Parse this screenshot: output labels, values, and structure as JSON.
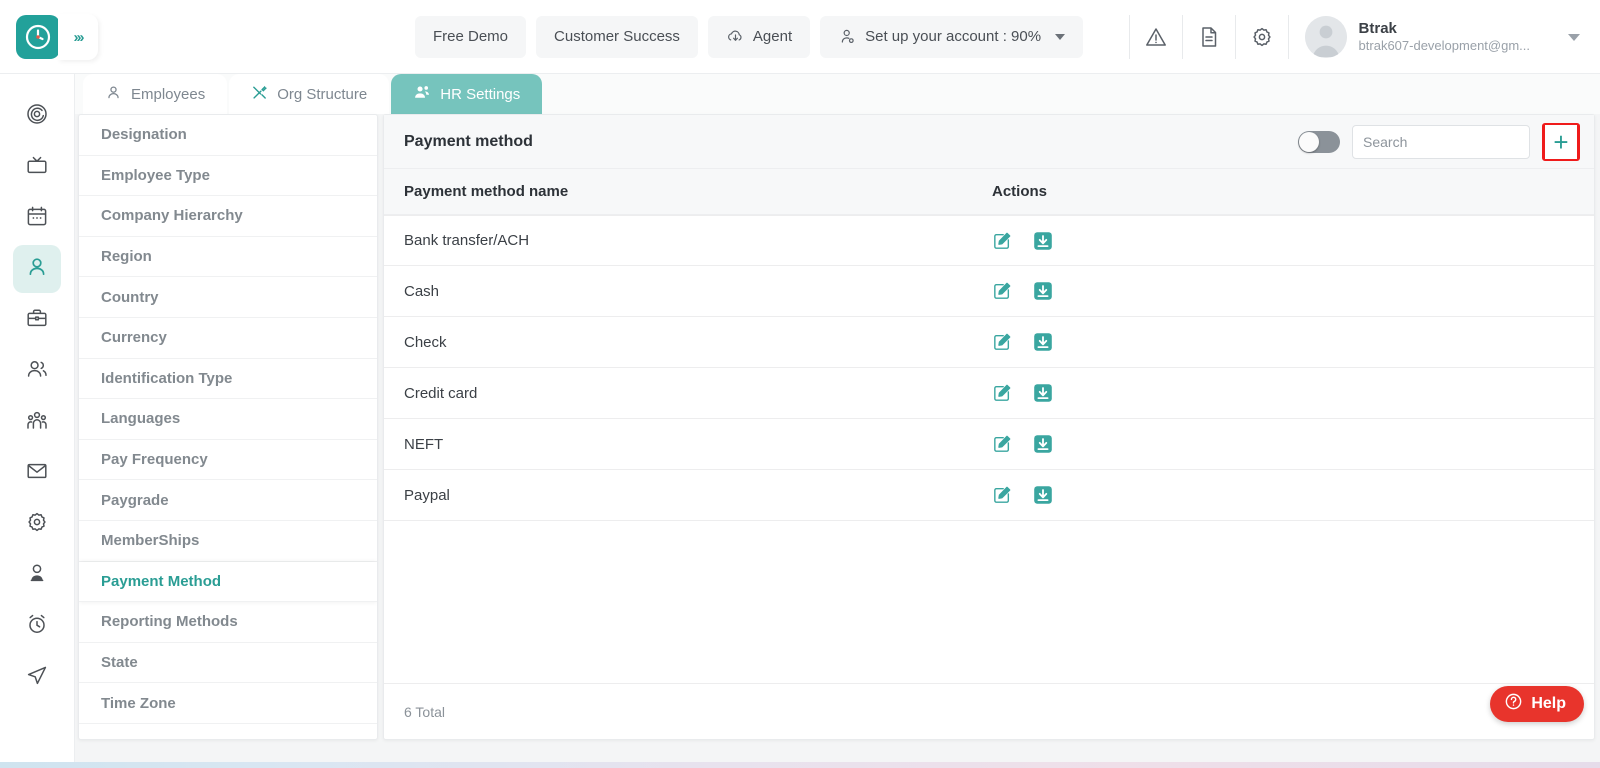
{
  "header": {
    "logo_icon": "clock-logo-icon",
    "expand_icon": "chevron-double-right-icon",
    "nav": [
      {
        "label": "Free Demo",
        "icon": null,
        "name": "free-demo-button"
      },
      {
        "label": "Customer Success",
        "icon": null,
        "name": "customer-success-button"
      },
      {
        "label": "Agent",
        "icon": "cloud-download-icon",
        "name": "agent-button"
      },
      {
        "label": "Set up your account : 90%",
        "icon": "user-gear-icon",
        "name": "setup-account-button"
      }
    ],
    "icons": [
      {
        "name": "warning-icon"
      },
      {
        "name": "document-icon"
      },
      {
        "name": "gear-icon"
      }
    ],
    "user": {
      "name": "Btrak",
      "email": "btrak607-development@gm...",
      "avatar_icon": "avatar-placeholder-icon",
      "caret_icon": "caret-down-icon"
    }
  },
  "rail": {
    "items": [
      {
        "name": "sidebar-rail-dashboard",
        "icon": "target-spiral-icon",
        "active": false
      },
      {
        "name": "sidebar-rail-tv",
        "icon": "tv-icon",
        "active": false
      },
      {
        "name": "sidebar-rail-calendar",
        "icon": "calendar-icon",
        "active": false
      },
      {
        "name": "sidebar-rail-employee",
        "icon": "person-icon",
        "active": true
      },
      {
        "name": "sidebar-rail-briefcase",
        "icon": "briefcase-icon",
        "active": false
      },
      {
        "name": "sidebar-rail-team",
        "icon": "two-people-icon",
        "active": false
      },
      {
        "name": "sidebar-rail-group",
        "icon": "people-group-icon",
        "active": false
      },
      {
        "name": "sidebar-rail-mail",
        "icon": "envelope-icon",
        "active": false
      },
      {
        "name": "sidebar-rail-settings",
        "icon": "gear-icon",
        "active": false
      },
      {
        "name": "sidebar-rail-profile",
        "icon": "user-badge-icon",
        "active": false
      },
      {
        "name": "sidebar-rail-timer",
        "icon": "alarm-clock-icon",
        "active": false
      },
      {
        "name": "sidebar-rail-send",
        "icon": "paper-plane-icon",
        "active": false
      }
    ]
  },
  "tabs": [
    {
      "label": "Employees",
      "icon": "person-icon",
      "active": false
    },
    {
      "label": "Org Structure",
      "icon": "tools-icon",
      "active": false
    },
    {
      "label": "HR Settings",
      "icon": "people-settings-icon",
      "active": true
    }
  ],
  "sidebar": {
    "items": [
      {
        "label": "Designation",
        "active": false
      },
      {
        "label": "Employee Type",
        "active": false
      },
      {
        "label": "Company Hierarchy",
        "active": false
      },
      {
        "label": "Region",
        "active": false
      },
      {
        "label": "Country",
        "active": false
      },
      {
        "label": "Currency",
        "active": false
      },
      {
        "label": "Identification Type",
        "active": false
      },
      {
        "label": "Languages",
        "active": false
      },
      {
        "label": "Pay Frequency",
        "active": false
      },
      {
        "label": "Paygrade",
        "active": false
      },
      {
        "label": "MemberShips",
        "active": false
      },
      {
        "label": "Payment Method",
        "active": true
      },
      {
        "label": "Reporting Methods",
        "active": false
      },
      {
        "label": "State",
        "active": false
      },
      {
        "label": "Time Zone",
        "active": false
      }
    ]
  },
  "panel": {
    "title": "Payment method",
    "toggle_on": false,
    "search": {
      "value": "",
      "placeholder": "Search"
    },
    "add_button": {
      "label": "+",
      "icon": "plus-icon",
      "highlighted": true,
      "highlight_color": "#ef1b1b"
    },
    "columns": [
      "Payment method name",
      "Actions"
    ],
    "rows": [
      {
        "name": "Bank transfer/ACH"
      },
      {
        "name": "Cash"
      },
      {
        "name": "Check"
      },
      {
        "name": "Credit card"
      },
      {
        "name": "NEFT"
      },
      {
        "name": "Paypal"
      }
    ],
    "row_actions": [
      {
        "name": "edit-icon"
      },
      {
        "name": "archive-down-icon"
      }
    ],
    "total_text": "6 Total"
  },
  "help": {
    "label": "Help",
    "icon": "question-circle-icon",
    "color": "#e8342c"
  },
  "colors": {
    "accent": "#2a9d94",
    "tab_active": "#76c4bd",
    "action_icon": "#3aa6a0",
    "highlight": "#ef1b1b",
    "help": "#e8342c"
  }
}
